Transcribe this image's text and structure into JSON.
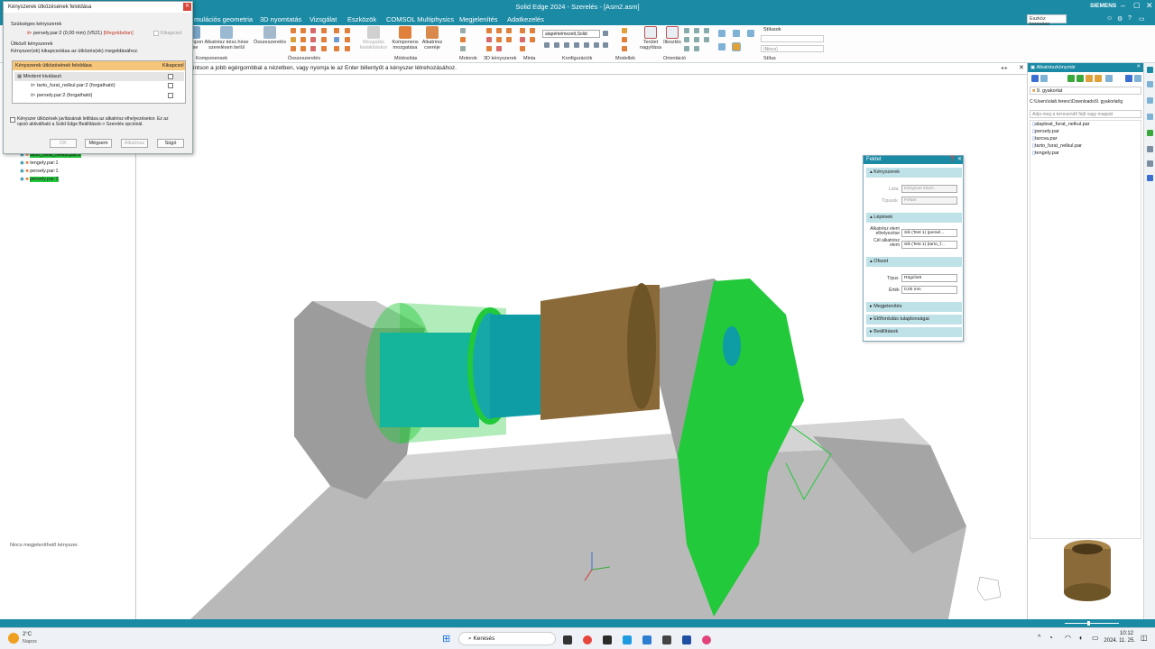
{
  "app": {
    "title": "Solid Edge 2024 - Szerelés - [Asm2.asm]",
    "brand": "SIEMENS",
    "search_placeholder": "Eszköz keresése"
  },
  "menu": {
    "items": [
      "mulációs geometria",
      "3D nyomtatás",
      "Vizsgálat",
      "Eszközök",
      "COMSOL Multiphysics",
      "Megjelenítés",
      "Adatkezelés"
    ]
  },
  "ribbon": {
    "buttons": [
      {
        "label": "Kompon\nése",
        "icon": "component-icon"
      },
      {
        "label": "Alkatrész kész.hése\nszerelésen belül",
        "icon": "part-in-place-icon"
      },
      {
        "label": "Összeszerelés",
        "icon": "assemble-icon"
      },
      {
        "label": "Mozgatás\nkialakításkor",
        "icon": "move-design-icon"
      },
      {
        "label": "Komponens\nmozgatása",
        "icon": "move-component-icon"
      },
      {
        "label": "Alkatrész\ncseréje",
        "icon": "replace-part-icon"
      },
      {
        "label": "Terület\nnagyítása",
        "icon": "zoom-area-icon"
      },
      {
        "label": "Illesztés",
        "icon": "fit-icon"
      }
    ],
    "groups": [
      "Komponensek",
      "Összeszerelés",
      "Módosítás",
      "Motorok",
      "3D kényszerek",
      "Minta",
      "Konfigurációk",
      "Modellek",
      "Orientáció",
      "Stílus"
    ],
    "config_select": "alapértelmezett,Solid",
    "style_label": "Stílusok",
    "style_select": "(Nincs)"
  },
  "dialog": {
    "title": "Kényszerek ütközésének feloldása",
    "section_needed": "Szükséges kényszerek",
    "needed_item": "persely.par:2",
    "needed_value": "(0,00 mm)",
    "needed_code": "(V521)",
    "needed_status": "[Megoldatlan]",
    "needed_toggle": "Kikapcsol",
    "section_conflict": "Ütköző kényszerek",
    "conflict_desc": "Kényszer(ek) kikapcsolása az ütközés(ek) megoldásához.",
    "table_headers": [
      "Kényszerek ütközésének feloldása",
      "Kikapcsol"
    ],
    "rows": [
      "Mindent kiválaszt",
      "tarto_furat_nelkul.par:2  (forgatható)",
      "persely.par:2  (forgatható)"
    ],
    "hint": "Kényszer ütközések javításának letiltása az alkatrész elhelyezésekor. Ez az opció aktiválható a Solid Edge Beállítások-> Szerelés opciónál.",
    "buttons": [
      "OK",
      "Mégsem",
      "Alkalmaz",
      "Súgó"
    ]
  },
  "prompt": {
    "text": "intson a jobb egérgombbal a nézetben, vagy nyomja le az Enter billentyűt a kényszer létrehozásához."
  },
  "tree": {
    "items": [
      "tarto_furat_nelkul.par:2",
      "tengely.par:1",
      "persely.par:1",
      "persely.par:2"
    ],
    "status": "Nincs megjeleníthető kényszer."
  },
  "fektet": {
    "title": "Fektet",
    "sections": [
      "Kényszerek",
      "Lépések",
      "Ofszet",
      "Megjelenítés",
      "Előfordulás tulajdonságai",
      "Beállítások"
    ],
    "lista_label": "Lista",
    "lista_value": "Kényszer készí...",
    "tipusok_label": "Típusok",
    "tipusok_value": "Fektet",
    "place_label": "Alkatrész elem elhelyezése",
    "place_value": "Sík (Test 1) (persel...",
    "target_label": "Cél alkatrész elem",
    "target_value": "Sík (Test 1) (tarto_f...",
    "tipus_label": "Típus",
    "tipus_value": "Rögzített",
    "ertek_label": "Érték",
    "ertek_value": "0,00 mm"
  },
  "library": {
    "title": "Alkatrészkönyvtár",
    "folder": "9. gyakorlat",
    "path": "C:\\Users\\olah.ferenc\\Downloads\\9. gyakorlat\\g",
    "search_placeholder": "Adja meg a keresendő fájlt vagy mappát",
    "files": [
      "alapteat_furat_nelkul.par",
      "persely.par",
      "tarcsa.par",
      "tarto_furat_nelkul.par",
      "tengely.par"
    ]
  },
  "taskbar": {
    "temp": "2°C",
    "weather": "Napos",
    "search": "Keresés",
    "time": "10:12",
    "date": "2024. 11. 25."
  },
  "colors": {
    "accent": "#1b8aa5",
    "green": "#22c93a",
    "bronze": "#8a6a38"
  }
}
